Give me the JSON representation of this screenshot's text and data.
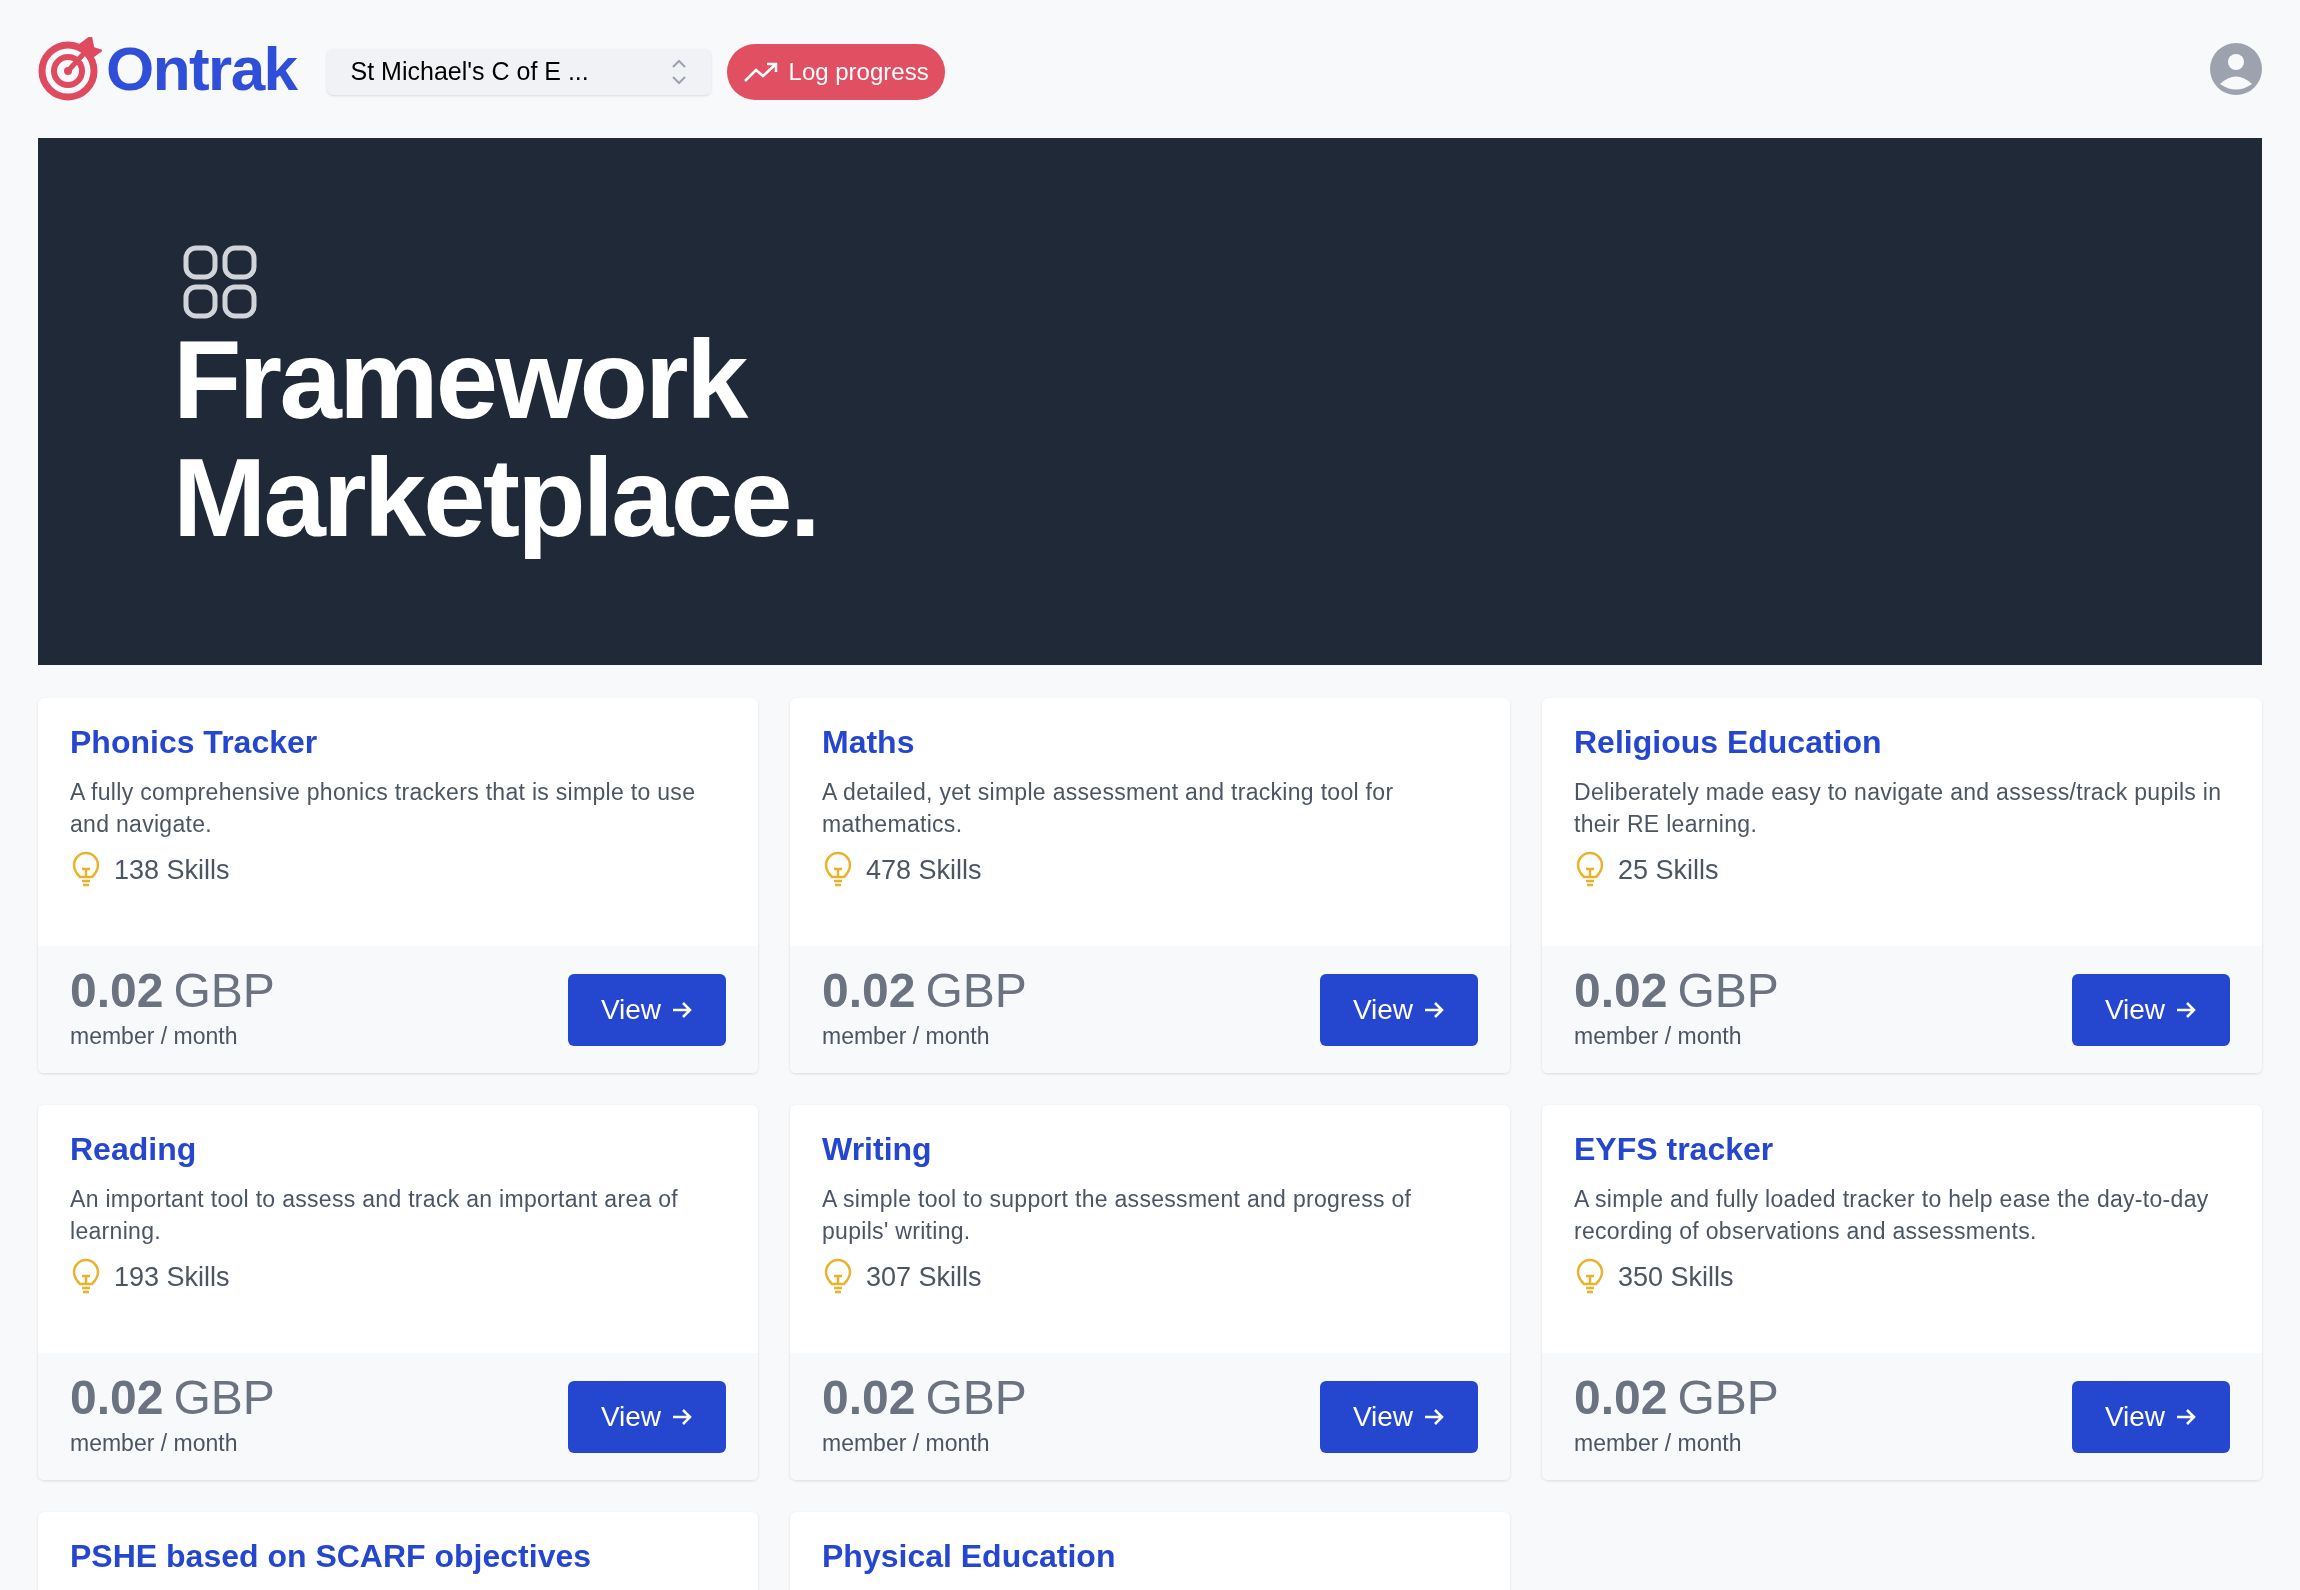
{
  "header": {
    "logo": "Ontrak",
    "school_select": {
      "value": "St Michael's C of E ..."
    },
    "log_button": "Log progress"
  },
  "hero": {
    "title_line_1": "Framework",
    "title_line_2": "Marketplace."
  },
  "frameworks": [
    {
      "title": "Phonics Tracker",
      "description": "A fully comprehensive phonics trackers that is simple to use and navigate.",
      "skills": "138 Skills",
      "price": "0.02",
      "currency": "GBP",
      "period": "member / month",
      "button": "View"
    },
    {
      "title": "Maths",
      "description": "A detailed, yet simple assessment and tracking tool for mathematics.",
      "skills": "478 Skills",
      "price": "0.02",
      "currency": "GBP",
      "period": "member / month",
      "button": "View"
    },
    {
      "title": "Religious Education",
      "description": "Deliberately made easy to navigate and assess/track pupils in their RE learning.",
      "skills": "25 Skills",
      "price": "0.02",
      "currency": "GBP",
      "period": "member / month",
      "button": "View"
    },
    {
      "title": "Reading",
      "description": "An important tool to assess and track an important area of learning.",
      "skills": "193 Skills",
      "price": "0.02",
      "currency": "GBP",
      "period": "member / month",
      "button": "View"
    },
    {
      "title": "Writing",
      "description": "A simple tool to support the assessment and progress of pupils' writing.",
      "skills": "307 Skills",
      "price": "0.02",
      "currency": "GBP",
      "period": "member / month",
      "button": "View"
    },
    {
      "title": "EYFS tracker",
      "description": "A simple and fully loaded tracker to help ease the day-to-day recording of observations and assessments.",
      "skills": "350 Skills",
      "price": "0.02",
      "currency": "GBP",
      "period": "member / month",
      "button": "View"
    },
    {
      "title": "PSHE based on SCARF objectives"
    },
    {
      "title": "Physical Education"
    }
  ]
}
